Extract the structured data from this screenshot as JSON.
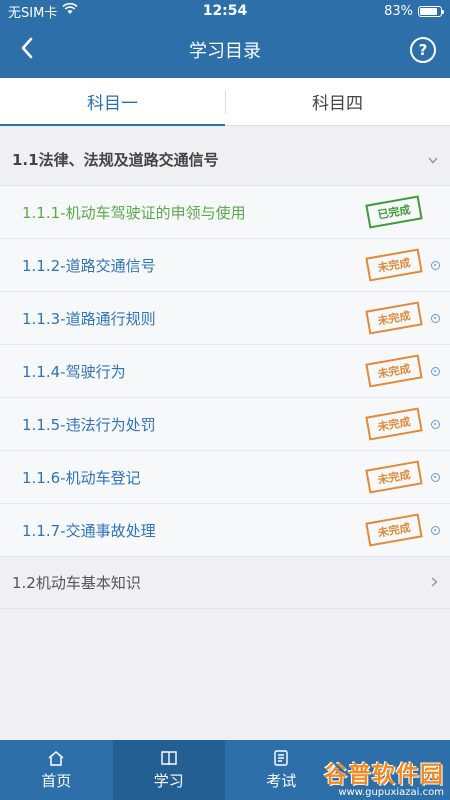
{
  "status": {
    "carrier": "无SIM卡",
    "time": "12:54",
    "battery": "83%",
    "battery_level": 0.83
  },
  "nav": {
    "title": "学习目录",
    "back_icon": "back-arrow-icon",
    "help_icon": "help-icon",
    "help_glyph": "?"
  },
  "tabs": [
    {
      "label": "科目一",
      "active": true
    },
    {
      "label": "科目四",
      "active": false
    }
  ],
  "sections": [
    {
      "title": "1.1法律、法规及道路交通信号",
      "expanded": true,
      "items": [
        {
          "label": "1.1.1-机动车驾驶证的申领与使用",
          "status": "已完成",
          "done": true
        },
        {
          "label": "1.1.2-道路交通信号",
          "status": "未完成",
          "done": false
        },
        {
          "label": "1.1.3-道路通行规则",
          "status": "未完成",
          "done": false
        },
        {
          "label": "1.1.4-驾驶行为",
          "status": "未完成",
          "done": false
        },
        {
          "label": "1.1.5-违法行为处罚",
          "status": "未完成",
          "done": false
        },
        {
          "label": "1.1.6-机动车登记",
          "status": "未完成",
          "done": false
        },
        {
          "label": "1.1.7-交通事故处理",
          "status": "未完成",
          "done": false
        }
      ]
    },
    {
      "title": "1.2机动车基本知识",
      "expanded": false,
      "items": []
    }
  ],
  "bottom_tabs": [
    {
      "label": "首页",
      "icon": "home-icon",
      "active": false
    },
    {
      "label": "学习",
      "icon": "book-icon",
      "active": true
    },
    {
      "label": "考试",
      "icon": "exam-icon",
      "active": false
    },
    {
      "label": "",
      "icon": "more-icon",
      "active": false
    }
  ],
  "watermark": {
    "main": "谷普软件园",
    "sub": "www.gupuxiazai.com"
  },
  "colors": {
    "primary": "#2d6fa9",
    "done": "#3f9a3b",
    "pending": "#e08a3a",
    "link": "#2e74b8"
  }
}
